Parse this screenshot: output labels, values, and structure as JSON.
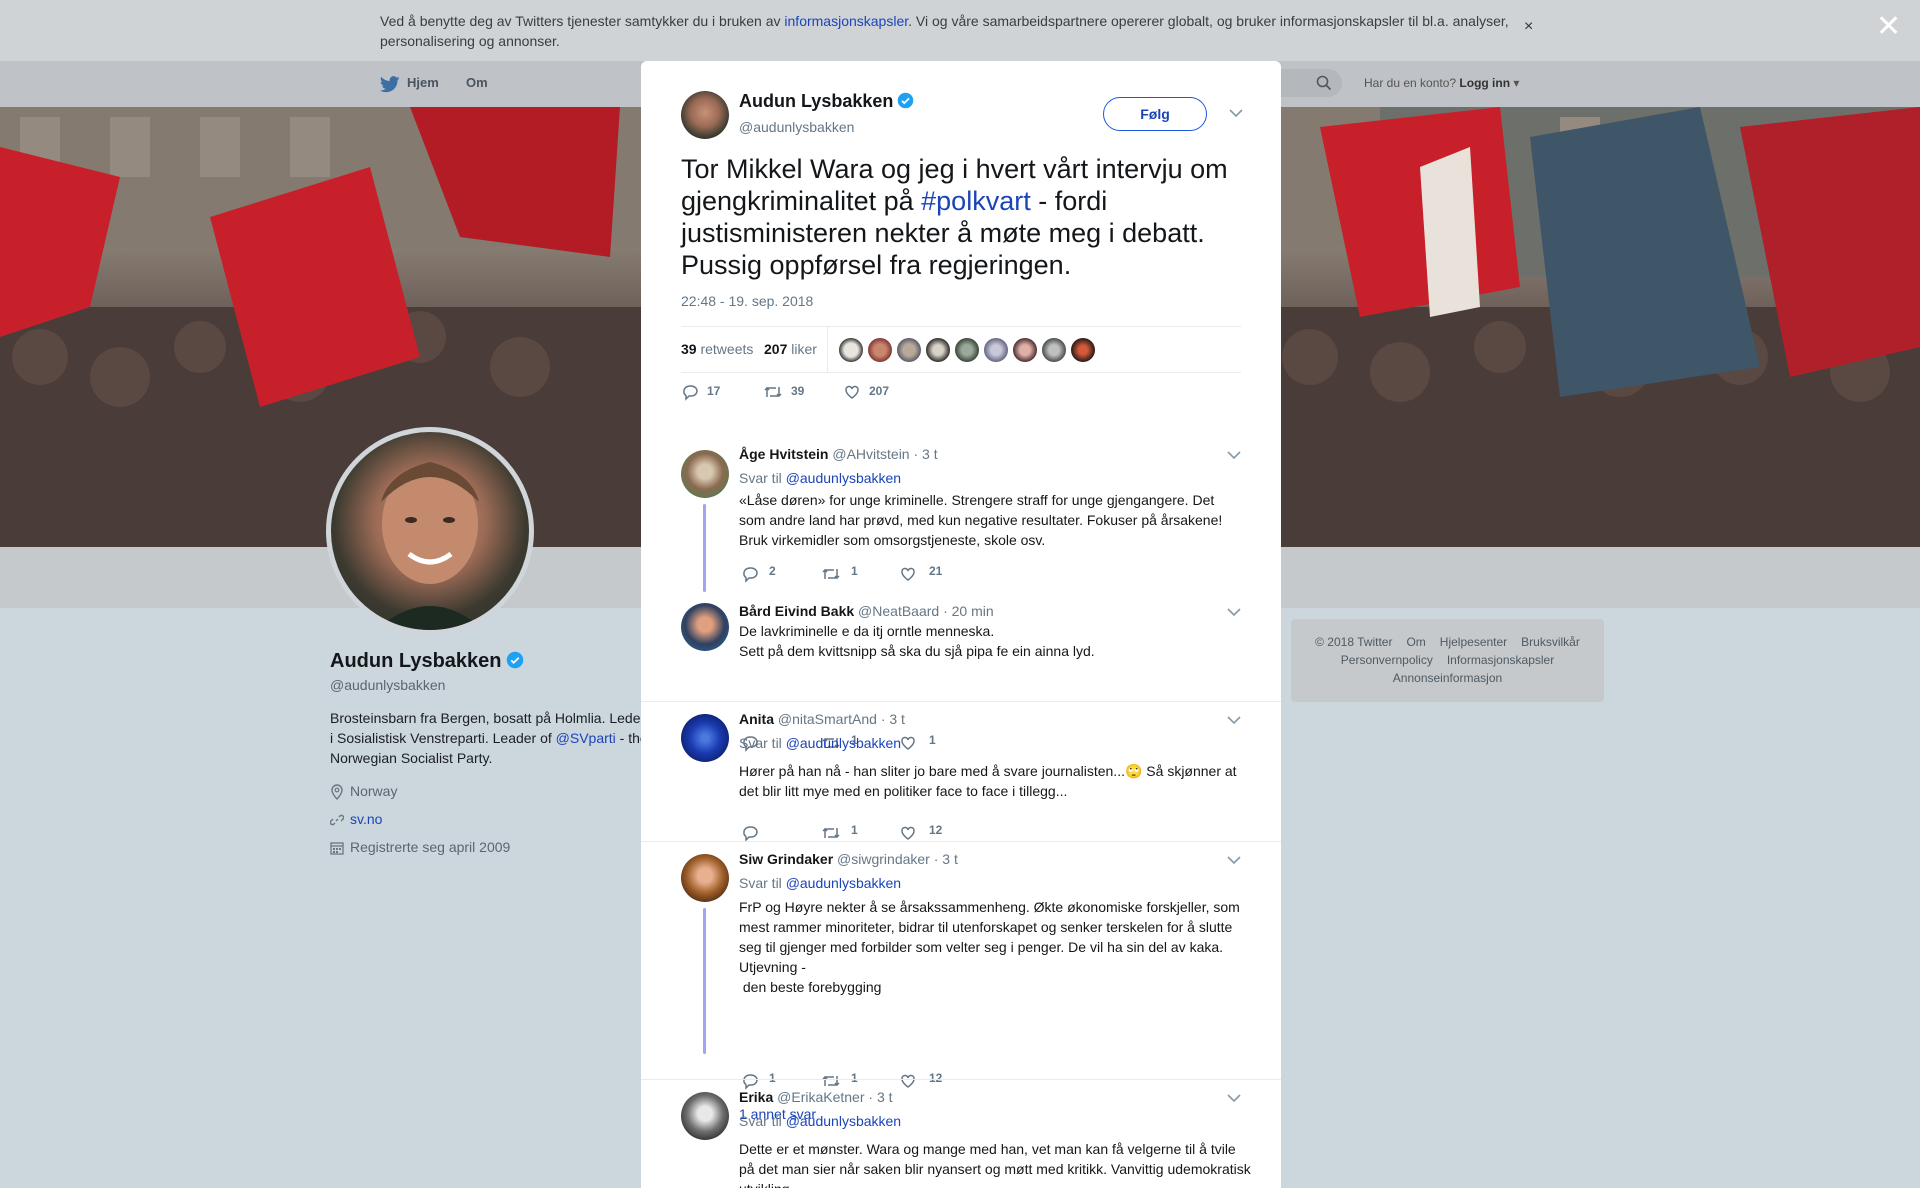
{
  "cookie_banner": {
    "text_before": "Ved å benytte deg av Twitters tjenester samtykker du i bruken av ",
    "link": "informasjonskapsler",
    "text_after": ". Vi og våre samarbeidspartnere opererer globalt, og bruker informasjonskapsler til bl.a. analyser, personalisering og annonser.",
    "close": "×"
  },
  "nav": {
    "home": "Hjem",
    "about": "Om",
    "have_account": "Har du en konto?",
    "login": "Logg inn"
  },
  "profile": {
    "name": "Audun Lysbakken",
    "handle": "@audunlysbakken",
    "bio_1": "Brosteinsbarn fra Bergen, bosatt på Holmlia. Leder i Sosialistisk Venstreparti. Leader of ",
    "bio_mention": "@SVparti",
    "bio_2": " - the Norwegian Socialist Party.",
    "location": "Norway",
    "website": "sv.no",
    "joined": "Registrerte seg april 2009"
  },
  "footer": {
    "links": [
      "© 2018 Twitter",
      "Om",
      "Hjelpesenter",
      "Bruksvilkår",
      "Personvernpolicy",
      "Informasjonskapsler",
      "Annonseinformasjon"
    ]
  },
  "overlay_close": "✕",
  "tweet": {
    "author_name": "Audun Lysbakken",
    "author_handle": "@audunlysbakken",
    "follow_label": "Følg",
    "text_1": "Tor Mikkel Wara og jeg i hvert vårt intervju om gjengkriminalitet på ",
    "hashtag": "#polkvart",
    "text_2": " - fordi justisministeren nekter å møte meg i debatt. Pussig oppførsel fra regjeringen.",
    "timestamp": "22:48 - 19. sep. 2018",
    "retweets_count": "39",
    "retweets_label": "retweets",
    "likes_count": "207",
    "likes_label": "liker",
    "reply_count": "17",
    "retweet_action_count": "39",
    "like_action_count": "207"
  },
  "replies": [
    {
      "name": "Åge Hvitstein",
      "handle": "@AHvitstein",
      "time": "· 3 t",
      "svar": "Svar til ",
      "mention": "@audunlysbakken",
      "text": "«Låse døren» for unge kriminelle. Strengere straff for unge gjengangere. Det som andre land har prøvd, med kun negative resultater. Fokuser på årsakene! Bruk virkemidler som omsorgstjeneste, skole osv.",
      "replies": "2",
      "retweets": "1",
      "likes": "21"
    },
    {
      "name": "Bård Eivind Bakk",
      "handle": "@NeatBaard",
      "time": "· 20 min",
      "text_1": "De lavkriminelle e da itj orntle menneska.",
      "text_2": "Sett på dem kvittsnipp så ska du sjå pipa fe ein ainna lyd.",
      "replies": "",
      "retweets": "1",
      "likes": "1"
    },
    {
      "name": "Anita",
      "handle": "@nitaSmartAnd",
      "time": "· 3 t",
      "svar": "Svar til ",
      "mention": "@audunlysbakken",
      "text_1": "Hører på han nå - han sliter jo bare med å svare journalisten...",
      "emoji": "🙄",
      "text_2": " Så skjønner at det blir litt mye med en politiker face to face i tillegg...",
      "replies": "",
      "retweets": "1",
      "likes": "12"
    },
    {
      "name": "Siw Grindaker",
      "handle": "@siwgrindaker",
      "time": "· 3 t",
      "svar": "Svar til ",
      "mention": "@audunlysbakken",
      "text_1": "FrP og Høyre nekter å se årsakssammenheng. Økte økonomiske forskjeller, som mest rammer minoriteter,  bidrar til utenforskapet og senker terskelen for å slutte seg til gjenger med forbilder som velter seg i penger. De vil ha sin del av kaka. Utjevning -",
      "text_2": " den beste forebygging",
      "replies": "1",
      "retweets": "1",
      "likes": "12",
      "more": "1 annet svar"
    },
    {
      "name": "Erika",
      "handle": "@ErikaKetner",
      "time": "· 3 t",
      "svar": "Svar til ",
      "mention": "@audunlysbakken",
      "text": "Dette er et mønster. Wara og mange med han, vet man kan få velgerne til å tvile på det man sier når saken blir nyansert og møtt med kritikk. Vanvittig udemokratisk utvikling"
    }
  ],
  "colors": {
    "link": "#1b44b8",
    "thread": "#a1a4f0",
    "verified": "#1da1f2"
  }
}
